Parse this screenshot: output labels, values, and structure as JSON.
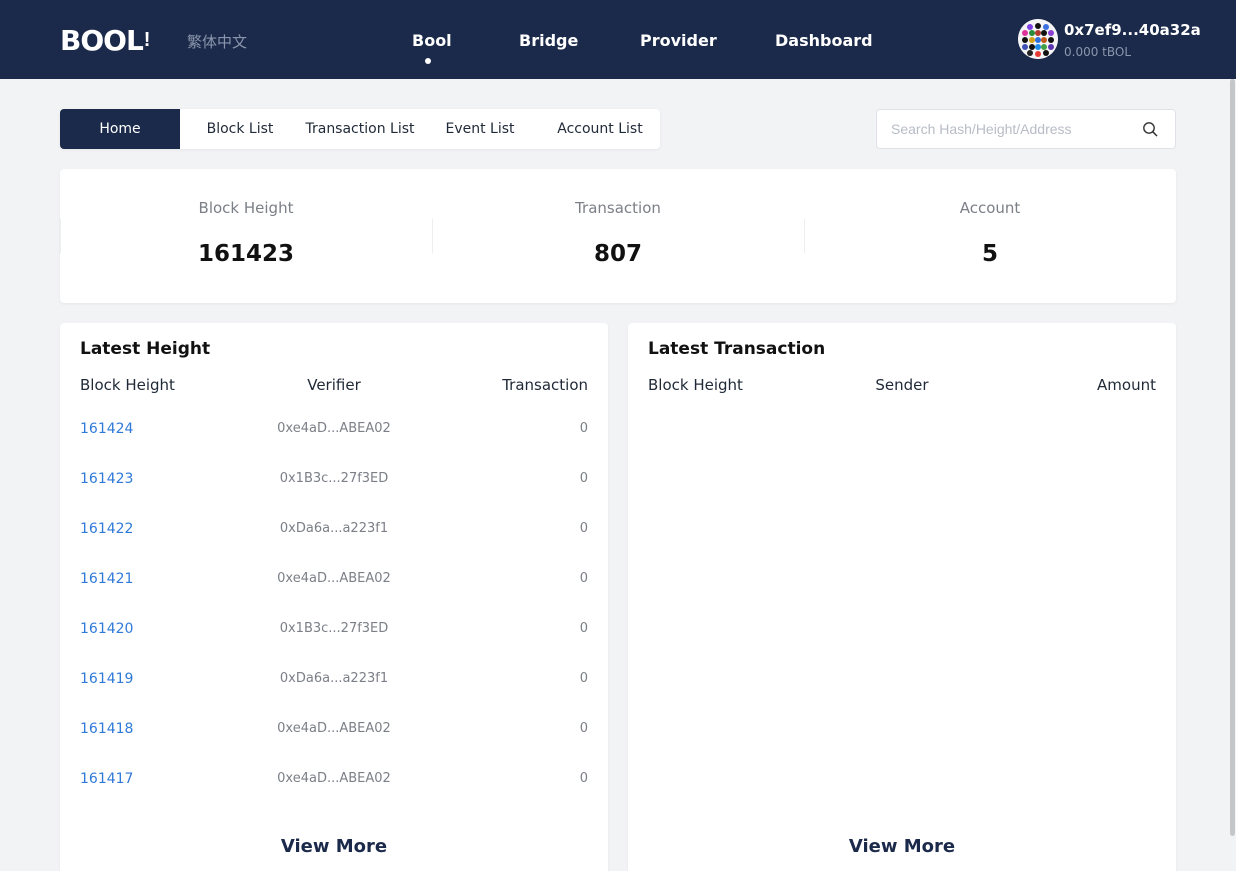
{
  "header": {
    "logo_text": "BOOL",
    "logo_suffix": "!",
    "language": "繁体中文",
    "nav": [
      {
        "label": "Bool",
        "active": true
      },
      {
        "label": "Bridge"
      },
      {
        "label": "Provider"
      },
      {
        "label": "Dashboard"
      }
    ],
    "wallet": {
      "address": "0x7ef9...40a32a",
      "balance": "0.000 tBOL"
    }
  },
  "tabs": [
    "Home",
    "Block List",
    "Transaction List",
    "Event List",
    "Account List"
  ],
  "active_tab": "Home",
  "search": {
    "placeholder": "Search Hash/Height/Address",
    "value": ""
  },
  "stats": [
    {
      "label": "Block Height",
      "value": "161423"
    },
    {
      "label": "Transaction",
      "value": "807"
    },
    {
      "label": "Account",
      "value": "5"
    }
  ],
  "latest_height": {
    "title": "Latest Height",
    "columns": [
      "Block Height",
      "Verifier",
      "Transaction"
    ],
    "rows": [
      {
        "height": "161424",
        "verifier": "0xe4aD...ABEA02",
        "transactions": "0"
      },
      {
        "height": "161423",
        "verifier": "0x1B3c...27f3ED",
        "transactions": "0"
      },
      {
        "height": "161422",
        "verifier": "0xDa6a...a223f1",
        "transactions": "0"
      },
      {
        "height": "161421",
        "verifier": "0xe4aD...ABEA02",
        "transactions": "0"
      },
      {
        "height": "161420",
        "verifier": "0x1B3c...27f3ED",
        "transactions": "0"
      },
      {
        "height": "161419",
        "verifier": "0xDa6a...a223f1",
        "transactions": "0"
      },
      {
        "height": "161418",
        "verifier": "0xe4aD...ABEA02",
        "transactions": "0"
      },
      {
        "height": "161417",
        "verifier": "0xe4aD...ABEA02",
        "transactions": "0"
      }
    ],
    "view_more": "View More"
  },
  "latest_transaction": {
    "title": "Latest Transaction",
    "columns": [
      "Block Height",
      "Sender",
      "Amount"
    ],
    "rows": [],
    "view_more": "View More"
  },
  "colors": {
    "header_bg": "#1b2a4a",
    "accent_link": "#2f7ad8",
    "page_bg": "#f2f3f5"
  }
}
